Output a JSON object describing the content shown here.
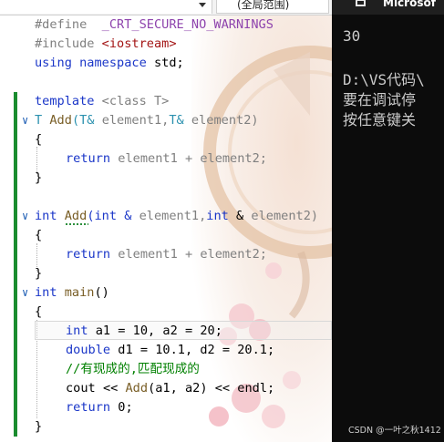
{
  "toolbar": {
    "scope_combo": "(全局范围)"
  },
  "editor": {
    "lines": {
      "l1": {
        "kw": "#define",
        "mac": "_CRT_SECURE_NO_WARNINGS"
      },
      "l2": {
        "kw": "#include",
        "str": "<iostream>"
      },
      "l3": {
        "a": "using",
        "b": "namespace",
        "c": "std;"
      },
      "l4": {
        "a": "template",
        "b": "<class",
        "c": "T>"
      },
      "l5": {
        "t": "T",
        "fn": "Add",
        "p1": "(T&",
        "a1": "element1,",
        "t2": "T&",
        "a2": "element2)"
      },
      "l6": "{",
      "l7": {
        "kw": "return",
        "rest": "element1 + element2;"
      },
      "l8": "}",
      "l9": {
        "kw": "int",
        "fn": "Add",
        "p": "(int &",
        "a1": "element1,",
        "kw2": "int",
        "amp": "&",
        "a2": "element2)"
      },
      "l10": "{",
      "l11": {
        "kw": "return",
        "rest": "element1 + element2;"
      },
      "l12": "}",
      "l13": {
        "kw": "int",
        "fn": "main",
        "rest": "()"
      },
      "l14": "{",
      "l15": {
        "kw": "int",
        "rest": "a1 = 10, a2 = 20;"
      },
      "l16": {
        "kw": "double",
        "rest": "d1 = 10.1, d2 = 20.1;"
      },
      "l17": {
        "cmt": "//有现成的,匹配现成的"
      },
      "l18": {
        "a": "cout",
        "b": "<<",
        "fn": "Add",
        "c": "(a1, a2)",
        "d": "<<",
        "e": "endl;"
      },
      "l19": {
        "kw": "return",
        "rest": "0;"
      },
      "l20": "}"
    }
  },
  "console": {
    "title": "Microsof",
    "output_value": "30",
    "path_line": "D:\\VS代码\\",
    "msg_line1": "要在调试停",
    "msg_line2": "按任意键关",
    "watermark": "CSDN @一叶之秋1412"
  },
  "colors": {
    "keyword": "#1a36c8",
    "type": "#2b91af",
    "function": "#795e26",
    "comment": "#008000",
    "string": "#a31515",
    "macro": "#8e44ad",
    "change_bar": "#1a8c2f",
    "console_bg": "#0c0c0c"
  }
}
